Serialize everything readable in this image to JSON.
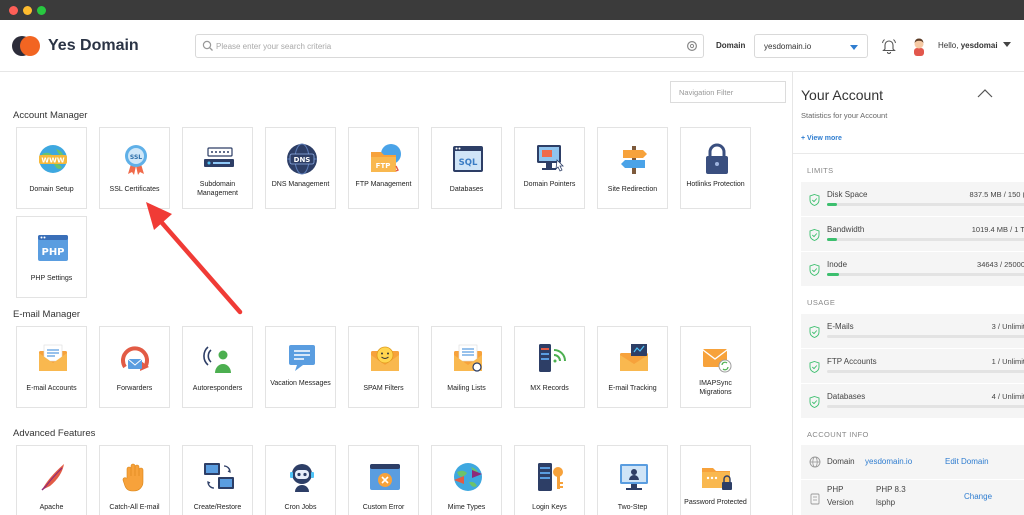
{
  "header": {
    "brand": "Yes Domain",
    "search_placeholder": "Please enter your search criteria",
    "domain_label": "Domain",
    "domain_value": "yesdomain.io",
    "greeting": "Hello,",
    "username": "yesdomai"
  },
  "nav_filter_placeholder": "Navigation Filter",
  "sections": {
    "account_manager": {
      "title": "Account Manager",
      "items": [
        {
          "label": "Domain Setup",
          "icon": "www-globe-icon"
        },
        {
          "label": "SSL Certificates",
          "icon": "ssl-badge-icon"
        },
        {
          "label": "Subdomain Management",
          "icon": "subdomain-icon"
        },
        {
          "label": "DNS Management",
          "icon": "dns-globe-icon"
        },
        {
          "label": "FTP Management",
          "icon": "ftp-folder-icon"
        },
        {
          "label": "Databases",
          "icon": "sql-database-icon"
        },
        {
          "label": "Domain Pointers",
          "icon": "domain-pointer-icon"
        },
        {
          "label": "Site Redirection",
          "icon": "signpost-icon"
        },
        {
          "label": "Hotlinks Protection",
          "icon": "padlock-icon"
        },
        {
          "label": "PHP Settings",
          "icon": "php-window-icon"
        }
      ]
    },
    "email_manager": {
      "title": "E-mail Manager",
      "items": [
        {
          "label": "E-mail Accounts",
          "icon": "envelope-icon"
        },
        {
          "label": "Forwarders",
          "icon": "forward-arrow-icon"
        },
        {
          "label": "Autoresponders",
          "icon": "autoresponder-icon"
        },
        {
          "label": "Vacation Messages",
          "icon": "vacation-message-icon"
        },
        {
          "label": "SPAM Filters",
          "icon": "spam-filter-icon"
        },
        {
          "label": "Mailing Lists",
          "icon": "mailing-list-icon"
        },
        {
          "label": "MX Records",
          "icon": "mx-records-icon"
        },
        {
          "label": "E-mail Tracking",
          "icon": "email-tracking-icon"
        },
        {
          "label": "IMAPSync Migrations",
          "icon": "imapsync-icon"
        }
      ]
    },
    "advanced_features": {
      "title": "Advanced Features",
      "items": [
        {
          "label": "Apache",
          "icon": "apache-feather-icon"
        },
        {
          "label": "Catch-All E-mail",
          "icon": "catch-all-hand-icon"
        },
        {
          "label": "Create/Restore",
          "icon": "backup-monitors-icon"
        },
        {
          "label": "Cron Jobs",
          "icon": "robot-icon"
        },
        {
          "label": "Custom Error",
          "icon": "error-page-icon"
        },
        {
          "label": "Mime Types",
          "icon": "mime-globe-icon"
        },
        {
          "label": "Login Keys",
          "icon": "login-key-icon"
        },
        {
          "label": "Two-Step",
          "icon": "two-step-icon"
        },
        {
          "label": "Password Protected",
          "icon": "password-folder-icon"
        }
      ]
    }
  },
  "account_panel": {
    "title": "Your Account",
    "subtitle": "Statistics for your Account",
    "view_more": "+ View more",
    "limits_heading": "LIMITS",
    "limits": [
      {
        "name": "Disk Space",
        "value": "837.5 MB / 150 (",
        "percent": 5
      },
      {
        "name": "Bandwidth",
        "value": "1019.4 MB / 1 T",
        "percent": 5
      },
      {
        "name": "Inode",
        "value": "34643 / 25000",
        "percent": 6
      }
    ],
    "usage_heading": "USAGE",
    "usage": [
      {
        "name": "E-Mails",
        "value": "3 / Unlimit",
        "percent": 0
      },
      {
        "name": "FTP Accounts",
        "value": "1 / Unlimit",
        "percent": 0
      },
      {
        "name": "Databases",
        "value": "4 / Unlimit",
        "percent": 0
      }
    ],
    "info_heading": "ACCOUNT INFO",
    "info": {
      "domain_key": "Domain",
      "domain_value": "yesdomain.io",
      "domain_action": "Edit Domain",
      "php_key_1": "PHP",
      "php_key_2": "Version",
      "php_value_1": "PHP 8.3",
      "php_value_2": "lsphp",
      "php_action": "Change"
    }
  },
  "colors": {
    "brand_orange": "#f26522",
    "link_blue": "#2f7dd0",
    "progress_green": "#3cbf6e",
    "arrow_red": "#f03b36"
  }
}
